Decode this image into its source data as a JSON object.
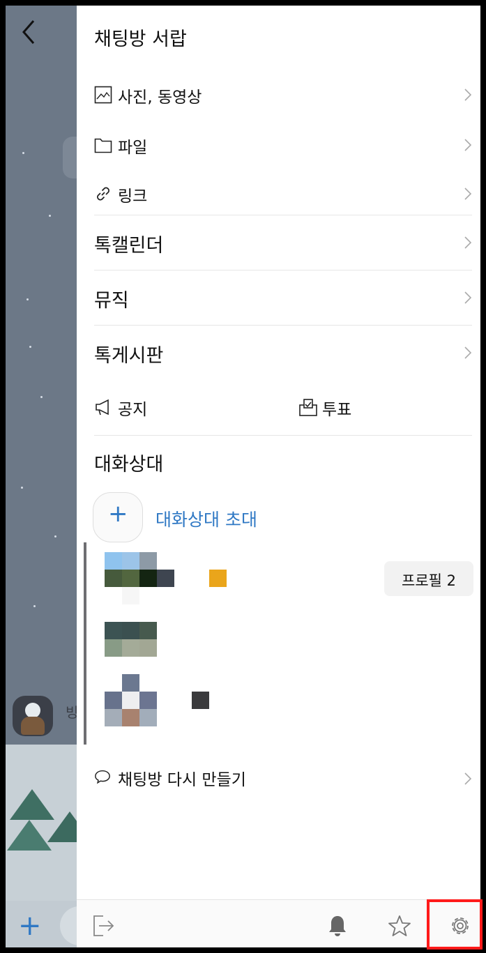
{
  "drawer": {
    "title": "채팅방 서랍",
    "items": [
      {
        "label": "사진, 동영상",
        "icon": "photo-icon"
      },
      {
        "label": "파일",
        "icon": "folder-icon"
      },
      {
        "label": "링크",
        "icon": "link-icon"
      }
    ],
    "big_items": [
      {
        "label": "톡캘린더"
      },
      {
        "label": "뮤직"
      },
      {
        "label": "톡게시판"
      }
    ],
    "notice_label": "공지",
    "vote_label": "투표",
    "participants": {
      "section_label": "대화상대",
      "invite_label": "대화상대 초대",
      "profile_button": "프로필 2"
    },
    "recreate_label": "채팅방 다시 만들기"
  },
  "background": {
    "name_fragment": "빙"
  },
  "colors": {
    "accent": "#2f78c4",
    "highlight": "#ff1a1a"
  }
}
